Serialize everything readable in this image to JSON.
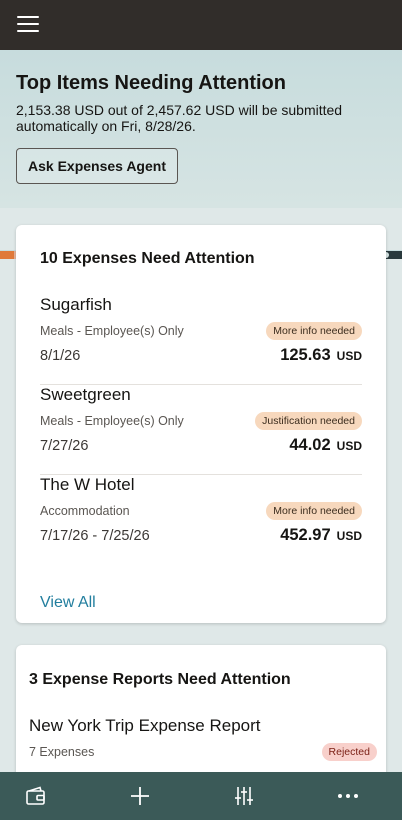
{
  "header": {
    "menu_icon": "hamburger-menu-icon"
  },
  "hero": {
    "title": "Top Items Needing Attention",
    "subtitle": "2,153.38 USD out of 2,457.62 USD will be submitted automatically on Fri, 8/28/26.",
    "agent_button": "Ask Expenses Agent"
  },
  "expenses_card": {
    "title": "10 Expenses Need Attention",
    "items": [
      {
        "name": "Sugarfish",
        "category": "Meals - Employee(s) Only",
        "date": "8/1/26",
        "badge": "More info needed",
        "amount": "125.63",
        "currency": "USD"
      },
      {
        "name": "Sweetgreen",
        "category": "Meals - Employee(s) Only",
        "date": "7/27/26",
        "badge": "Justification needed",
        "amount": "44.02",
        "currency": "USD"
      },
      {
        "name": "The W Hotel",
        "category": "Accommodation",
        "date": "7/17/26 - 7/25/26",
        "badge": "More info needed",
        "amount": "452.97",
        "currency": "USD"
      }
    ],
    "view_all": "View All"
  },
  "reports_card": {
    "title": "3 Expense Reports Need Attention",
    "report": {
      "name": "New York Trip Expense Report",
      "count": "7 Expenses",
      "status": "Rejected"
    }
  },
  "bottom_nav": {
    "items": [
      {
        "icon": "wallet-icon"
      },
      {
        "icon": "plus-icon"
      },
      {
        "icon": "sliders-icon"
      },
      {
        "icon": "more-icon"
      }
    ]
  },
  "colors": {
    "header": "#312d2a",
    "bottom_nav": "#3b5a58",
    "link": "#227e9e",
    "badge": "#f7d8bd",
    "rejected_badge": "#f8d0cb"
  }
}
